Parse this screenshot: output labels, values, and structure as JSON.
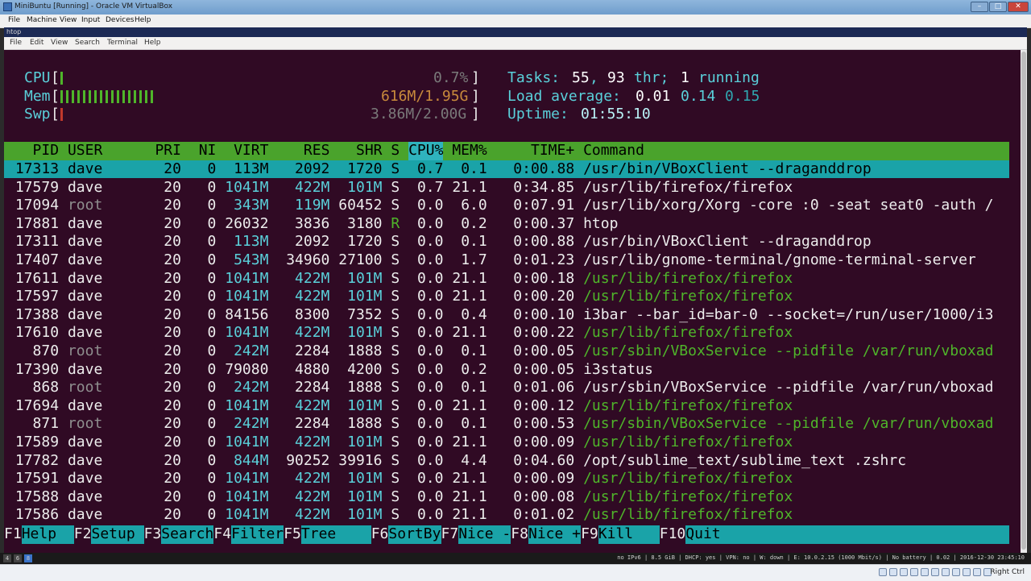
{
  "window": {
    "title": "MiniBuntu [Running] - Oracle VM VirtualBox",
    "controls": [
      "–",
      "□",
      "✕"
    ]
  },
  "vbox_menu": [
    "File",
    "Machine",
    "View",
    "Input",
    "Devices",
    "Help"
  ],
  "terminal_window": {
    "title": "htop",
    "menu": [
      "File",
      "Edit",
      "View",
      "Search",
      "Terminal",
      "Help"
    ]
  },
  "meters": {
    "cpu": {
      "label": "CPU",
      "value": "0.7%",
      "fraction": 0.007
    },
    "mem": {
      "label": "Mem",
      "value": "616M/1.95G",
      "fraction": 0.31
    },
    "swp": {
      "label": "Swp",
      "value": "3.86M/2.00G",
      "fraction": 0.002
    }
  },
  "summary": {
    "tasks_label": "Tasks:",
    "tasks": "55",
    "threads": "93",
    "thr_label": "thr;",
    "running": "1",
    "running_label": "running",
    "load_label": "Load average:",
    "load1": "0.01",
    "load5": "0.14",
    "load15": "0.15",
    "uptime_label": "Uptime:",
    "uptime": "01:55:10"
  },
  "columns": [
    "PID",
    "USER",
    "PRI",
    "NI",
    "VIRT",
    "RES",
    "SHR",
    "S",
    "CPU%",
    "MEM%",
    "TIME+",
    "Command"
  ],
  "processes": [
    {
      "pid": "17313",
      "user": "dave",
      "pri": "20",
      "ni": "0",
      "virt": "113M",
      "res": "2092",
      "shr": "1720",
      "s": "S",
      "cpu": "0.7",
      "mem": "0.1",
      "time": "0:00.88",
      "cmd": "/usr/bin/VBoxClient --draganddrop",
      "selected": true
    },
    {
      "pid": "17579",
      "user": "dave",
      "pri": "20",
      "ni": "0",
      "virt": "1041M",
      "res": "422M",
      "shr": "101M",
      "s": "S",
      "cpu": "0.7",
      "mem": "21.1",
      "time": "0:34.85",
      "cmd": "/usr/lib/firefox/firefox"
    },
    {
      "pid": "17094",
      "user": "root",
      "pri": "20",
      "ni": "0",
      "virt": "343M",
      "res": "119M",
      "shr": "60452",
      "s": "S",
      "cpu": "0.0",
      "mem": "6.0",
      "time": "0:07.91",
      "cmd": "/usr/lib/xorg/Xorg -core :0 -seat seat0 -auth /"
    },
    {
      "pid": "17881",
      "user": "dave",
      "pri": "20",
      "ni": "0",
      "virt": "26032",
      "res": "3836",
      "shr": "3180",
      "s": "R",
      "cpu": "0.0",
      "mem": "0.2",
      "time": "0:00.37",
      "cmd": "htop"
    },
    {
      "pid": "17311",
      "user": "dave",
      "pri": "20",
      "ni": "0",
      "virt": "113M",
      "res": "2092",
      "shr": "1720",
      "s": "S",
      "cpu": "0.0",
      "mem": "0.1",
      "time": "0:00.88",
      "cmd": "/usr/bin/VBoxClient --draganddrop"
    },
    {
      "pid": "17407",
      "user": "dave",
      "pri": "20",
      "ni": "0",
      "virt": "543M",
      "res": "34960",
      "shr": "27100",
      "s": "S",
      "cpu": "0.0",
      "mem": "1.7",
      "time": "0:01.23",
      "cmd": "/usr/lib/gnome-terminal/gnome-terminal-server"
    },
    {
      "pid": "17611",
      "user": "dave",
      "pri": "20",
      "ni": "0",
      "virt": "1041M",
      "res": "422M",
      "shr": "101M",
      "s": "S",
      "cpu": "0.0",
      "mem": "21.1",
      "time": "0:00.18",
      "cmd": "/usr/lib/firefox/firefox",
      "thread": true
    },
    {
      "pid": "17597",
      "user": "dave",
      "pri": "20",
      "ni": "0",
      "virt": "1041M",
      "res": "422M",
      "shr": "101M",
      "s": "S",
      "cpu": "0.0",
      "mem": "21.1",
      "time": "0:00.20",
      "cmd": "/usr/lib/firefox/firefox",
      "thread": true
    },
    {
      "pid": "17388",
      "user": "dave",
      "pri": "20",
      "ni": "0",
      "virt": "84156",
      "res": "8300",
      "shr": "7352",
      "s": "S",
      "cpu": "0.0",
      "mem": "0.4",
      "time": "0:00.10",
      "cmd": "i3bar --bar_id=bar-0 --socket=/run/user/1000/i3"
    },
    {
      "pid": "17610",
      "user": "dave",
      "pri": "20",
      "ni": "0",
      "virt": "1041M",
      "res": "422M",
      "shr": "101M",
      "s": "S",
      "cpu": "0.0",
      "mem": "21.1",
      "time": "0:00.22",
      "cmd": "/usr/lib/firefox/firefox",
      "thread": true
    },
    {
      "pid": "870",
      "user": "root",
      "pri": "20",
      "ni": "0",
      "virt": "242M",
      "res": "2284",
      "shr": "1888",
      "s": "S",
      "cpu": "0.0",
      "mem": "0.1",
      "time": "0:00.05",
      "cmd": "/usr/sbin/VBoxService --pidfile /var/run/vboxad",
      "thread": true
    },
    {
      "pid": "17390",
      "user": "dave",
      "pri": "20",
      "ni": "0",
      "virt": "79080",
      "res": "4880",
      "shr": "4200",
      "s": "S",
      "cpu": "0.0",
      "mem": "0.2",
      "time": "0:00.05",
      "cmd": "i3status"
    },
    {
      "pid": "868",
      "user": "root",
      "pri": "20",
      "ni": "0",
      "virt": "242M",
      "res": "2284",
      "shr": "1888",
      "s": "S",
      "cpu": "0.0",
      "mem": "0.1",
      "time": "0:01.06",
      "cmd": "/usr/sbin/VBoxService --pidfile /var/run/vboxad"
    },
    {
      "pid": "17694",
      "user": "dave",
      "pri": "20",
      "ni": "0",
      "virt": "1041M",
      "res": "422M",
      "shr": "101M",
      "s": "S",
      "cpu": "0.0",
      "mem": "21.1",
      "time": "0:00.12",
      "cmd": "/usr/lib/firefox/firefox",
      "thread": true
    },
    {
      "pid": "871",
      "user": "root",
      "pri": "20",
      "ni": "0",
      "virt": "242M",
      "res": "2284",
      "shr": "1888",
      "s": "S",
      "cpu": "0.0",
      "mem": "0.1",
      "time": "0:00.53",
      "cmd": "/usr/sbin/VBoxService --pidfile /var/run/vboxad",
      "thread": true
    },
    {
      "pid": "17589",
      "user": "dave",
      "pri": "20",
      "ni": "0",
      "virt": "1041M",
      "res": "422M",
      "shr": "101M",
      "s": "S",
      "cpu": "0.0",
      "mem": "21.1",
      "time": "0:00.09",
      "cmd": "/usr/lib/firefox/firefox",
      "thread": true
    },
    {
      "pid": "17782",
      "user": "dave",
      "pri": "20",
      "ni": "0",
      "virt": "844M",
      "res": "90252",
      "shr": "39916",
      "s": "S",
      "cpu": "0.0",
      "mem": "4.4",
      "time": "0:04.60",
      "cmd": "/opt/sublime_text/sublime_text .zshrc"
    },
    {
      "pid": "17591",
      "user": "dave",
      "pri": "20",
      "ni": "0",
      "virt": "1041M",
      "res": "422M",
      "shr": "101M",
      "s": "S",
      "cpu": "0.0",
      "mem": "21.1",
      "time": "0:00.09",
      "cmd": "/usr/lib/firefox/firefox",
      "thread": true
    },
    {
      "pid": "17588",
      "user": "dave",
      "pri": "20",
      "ni": "0",
      "virt": "1041M",
      "res": "422M",
      "shr": "101M",
      "s": "S",
      "cpu": "0.0",
      "mem": "21.1",
      "time": "0:00.08",
      "cmd": "/usr/lib/firefox/firefox",
      "thread": true
    },
    {
      "pid": "17586",
      "user": "dave",
      "pri": "20",
      "ni": "0",
      "virt": "1041M",
      "res": "422M",
      "shr": "101M",
      "s": "S",
      "cpu": "0.0",
      "mem": "21.1",
      "time": "0:01.02",
      "cmd": "/usr/lib/firefox/firefox",
      "thread": true
    }
  ],
  "function_keys": [
    {
      "key": "F1",
      "label": "Help"
    },
    {
      "key": "F2",
      "label": "Setup"
    },
    {
      "key": "F3",
      "label": "Search"
    },
    {
      "key": "F4",
      "label": "Filter"
    },
    {
      "key": "F5",
      "label": "Tree"
    },
    {
      "key": "F6",
      "label": "SortBy"
    },
    {
      "key": "F7",
      "label": "Nice -"
    },
    {
      "key": "F8",
      "label": "Nice +"
    },
    {
      "key": "F9",
      "label": "Kill"
    },
    {
      "key": "F10",
      "label": "Quit"
    }
  ],
  "host_bar": {
    "workspaces": [
      "4",
      "6",
      "8"
    ],
    "status": "no IPv6 | 8.5 GiB | DHCP: yes | VPN: no | W: down | E: 10.0.2.15 (1000 Mbit/s) | No battery | 0.02 | 2016-12-30 23:45:10"
  },
  "vbox_status": {
    "host_key": "Right Ctrl"
  },
  "colors": {
    "terminal_bg": "#300a24",
    "header_bg": "#4aa32c",
    "selection_bg": "#1aa3a8",
    "cyan": "#5ad0da",
    "thread_green": "#4fb52a"
  }
}
